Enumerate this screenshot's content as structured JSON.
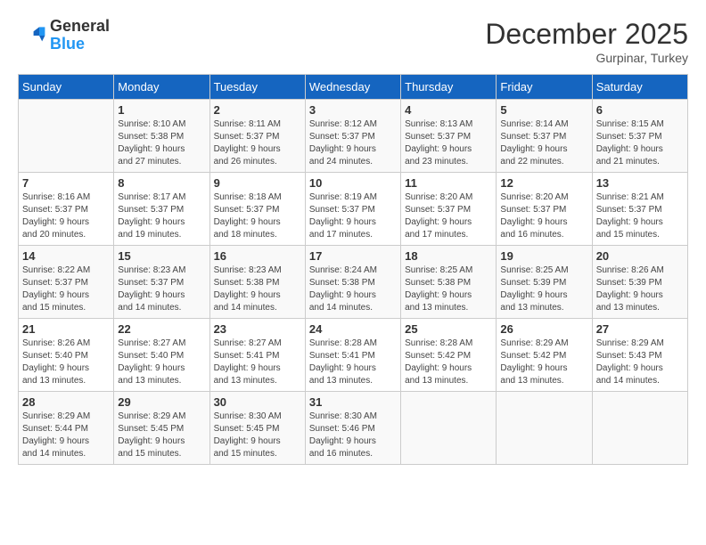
{
  "header": {
    "logo": {
      "line1": "General",
      "line2": "Blue"
    },
    "title": "December 2025",
    "location": "Gurpinar, Turkey"
  },
  "weekdays": [
    "Sunday",
    "Monday",
    "Tuesday",
    "Wednesday",
    "Thursday",
    "Friday",
    "Saturday"
  ],
  "weeks": [
    [
      {
        "day": "",
        "info": ""
      },
      {
        "day": "1",
        "info": "Sunrise: 8:10 AM\nSunset: 5:38 PM\nDaylight: 9 hours\nand 27 minutes."
      },
      {
        "day": "2",
        "info": "Sunrise: 8:11 AM\nSunset: 5:37 PM\nDaylight: 9 hours\nand 26 minutes."
      },
      {
        "day": "3",
        "info": "Sunrise: 8:12 AM\nSunset: 5:37 PM\nDaylight: 9 hours\nand 24 minutes."
      },
      {
        "day": "4",
        "info": "Sunrise: 8:13 AM\nSunset: 5:37 PM\nDaylight: 9 hours\nand 23 minutes."
      },
      {
        "day": "5",
        "info": "Sunrise: 8:14 AM\nSunset: 5:37 PM\nDaylight: 9 hours\nand 22 minutes."
      },
      {
        "day": "6",
        "info": "Sunrise: 8:15 AM\nSunset: 5:37 PM\nDaylight: 9 hours\nand 21 minutes."
      }
    ],
    [
      {
        "day": "7",
        "info": "Sunrise: 8:16 AM\nSunset: 5:37 PM\nDaylight: 9 hours\nand 20 minutes."
      },
      {
        "day": "8",
        "info": "Sunrise: 8:17 AM\nSunset: 5:37 PM\nDaylight: 9 hours\nand 19 minutes."
      },
      {
        "day": "9",
        "info": "Sunrise: 8:18 AM\nSunset: 5:37 PM\nDaylight: 9 hours\nand 18 minutes."
      },
      {
        "day": "10",
        "info": "Sunrise: 8:19 AM\nSunset: 5:37 PM\nDaylight: 9 hours\nand 17 minutes."
      },
      {
        "day": "11",
        "info": "Sunrise: 8:20 AM\nSunset: 5:37 PM\nDaylight: 9 hours\nand 17 minutes."
      },
      {
        "day": "12",
        "info": "Sunrise: 8:20 AM\nSunset: 5:37 PM\nDaylight: 9 hours\nand 16 minutes."
      },
      {
        "day": "13",
        "info": "Sunrise: 8:21 AM\nSunset: 5:37 PM\nDaylight: 9 hours\nand 15 minutes."
      }
    ],
    [
      {
        "day": "14",
        "info": "Sunrise: 8:22 AM\nSunset: 5:37 PM\nDaylight: 9 hours\nand 15 minutes."
      },
      {
        "day": "15",
        "info": "Sunrise: 8:23 AM\nSunset: 5:37 PM\nDaylight: 9 hours\nand 14 minutes."
      },
      {
        "day": "16",
        "info": "Sunrise: 8:23 AM\nSunset: 5:38 PM\nDaylight: 9 hours\nand 14 minutes."
      },
      {
        "day": "17",
        "info": "Sunrise: 8:24 AM\nSunset: 5:38 PM\nDaylight: 9 hours\nand 14 minutes."
      },
      {
        "day": "18",
        "info": "Sunrise: 8:25 AM\nSunset: 5:38 PM\nDaylight: 9 hours\nand 13 minutes."
      },
      {
        "day": "19",
        "info": "Sunrise: 8:25 AM\nSunset: 5:39 PM\nDaylight: 9 hours\nand 13 minutes."
      },
      {
        "day": "20",
        "info": "Sunrise: 8:26 AM\nSunset: 5:39 PM\nDaylight: 9 hours\nand 13 minutes."
      }
    ],
    [
      {
        "day": "21",
        "info": "Sunrise: 8:26 AM\nSunset: 5:40 PM\nDaylight: 9 hours\nand 13 minutes."
      },
      {
        "day": "22",
        "info": "Sunrise: 8:27 AM\nSunset: 5:40 PM\nDaylight: 9 hours\nand 13 minutes."
      },
      {
        "day": "23",
        "info": "Sunrise: 8:27 AM\nSunset: 5:41 PM\nDaylight: 9 hours\nand 13 minutes."
      },
      {
        "day": "24",
        "info": "Sunrise: 8:28 AM\nSunset: 5:41 PM\nDaylight: 9 hours\nand 13 minutes."
      },
      {
        "day": "25",
        "info": "Sunrise: 8:28 AM\nSunset: 5:42 PM\nDaylight: 9 hours\nand 13 minutes."
      },
      {
        "day": "26",
        "info": "Sunrise: 8:29 AM\nSunset: 5:42 PM\nDaylight: 9 hours\nand 13 minutes."
      },
      {
        "day": "27",
        "info": "Sunrise: 8:29 AM\nSunset: 5:43 PM\nDaylight: 9 hours\nand 14 minutes."
      }
    ],
    [
      {
        "day": "28",
        "info": "Sunrise: 8:29 AM\nSunset: 5:44 PM\nDaylight: 9 hours\nand 14 minutes."
      },
      {
        "day": "29",
        "info": "Sunrise: 8:29 AM\nSunset: 5:45 PM\nDaylight: 9 hours\nand 15 minutes."
      },
      {
        "day": "30",
        "info": "Sunrise: 8:30 AM\nSunset: 5:45 PM\nDaylight: 9 hours\nand 15 minutes."
      },
      {
        "day": "31",
        "info": "Sunrise: 8:30 AM\nSunset: 5:46 PM\nDaylight: 9 hours\nand 16 minutes."
      },
      {
        "day": "",
        "info": ""
      },
      {
        "day": "",
        "info": ""
      },
      {
        "day": "",
        "info": ""
      }
    ]
  ]
}
